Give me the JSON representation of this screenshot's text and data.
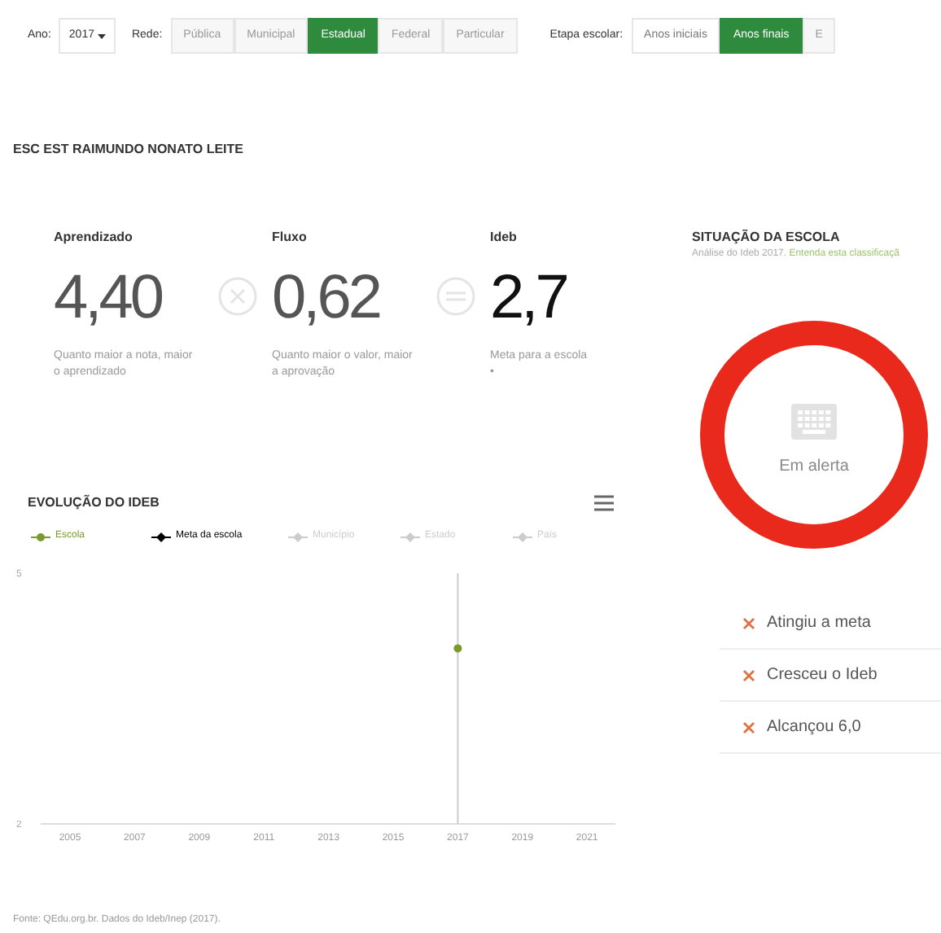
{
  "filters": {
    "year": {
      "label": "Ano:",
      "value": "2017"
    },
    "network": {
      "label": "Rede:",
      "options": [
        {
          "label": "Pública",
          "selected": false,
          "disabled": true
        },
        {
          "label": "Municipal",
          "selected": false,
          "disabled": true
        },
        {
          "label": "Estadual",
          "selected": true,
          "disabled": false
        },
        {
          "label": "Federal",
          "selected": false,
          "disabled": true
        },
        {
          "label": "Particular",
          "selected": false,
          "disabled": true
        }
      ]
    },
    "stage": {
      "label": "Etapa escolar:",
      "options": [
        {
          "label": "Anos iniciais",
          "selected": false,
          "disabled": false
        },
        {
          "label": "Anos finais",
          "selected": true,
          "disabled": false
        },
        {
          "label": "E",
          "selected": false,
          "disabled": true
        }
      ]
    }
  },
  "school_name": "ESC EST RAIMUNDO NONATO LEITE",
  "metrics": [
    {
      "title": "Aprendizado",
      "value": "4,40",
      "description": "Quanto maior a nota, maior o aprendizado",
      "highlight": false
    },
    {
      "title": "Fluxo",
      "value": "0,62",
      "description": "Quanto maior o valor, maior a aprovação",
      "highlight": false
    },
    {
      "title": "Ideb",
      "value": "2,7",
      "description": "Meta para a escola",
      "note": "•",
      "highlight": true
    }
  ],
  "situation": {
    "title": "SITUAÇÃO DA ESCOLA",
    "subtitle": "Análise do Ideb 2017.",
    "link": "Entenda esta classificaçã",
    "status": "Em alerta",
    "color": "#e8291c",
    "checks": [
      {
        "label": "Atingiu a meta",
        "met": false
      },
      {
        "label": "Cresceu o Ideb",
        "met": false
      },
      {
        "label": "Alcançou 6,0",
        "met": false
      }
    ]
  },
  "evolution": {
    "title": "EVOLUÇÃO DO IDEB",
    "chart_data": {
      "type": "line",
      "x": [
        "2005",
        "2007",
        "2009",
        "2011",
        "2013",
        "2015",
        "2017",
        "2019",
        "2021"
      ],
      "series": [
        {
          "name": "Escola",
          "color": "#7a9a2a",
          "marker": "circle",
          "values": [
            null,
            null,
            null,
            null,
            null,
            null,
            4.1,
            null,
            null
          ]
        },
        {
          "name": "Meta da escola",
          "color": "#000000",
          "marker": "diamond",
          "values": [
            null,
            null,
            null,
            null,
            null,
            null,
            null,
            null,
            null
          ]
        },
        {
          "name": "Município",
          "color": "#cccccc",
          "marker": "diamond",
          "values": [
            null,
            null,
            null,
            null,
            null,
            null,
            null,
            null,
            null
          ]
        },
        {
          "name": "Estado",
          "color": "#cccccc",
          "marker": "diamond",
          "values": [
            null,
            null,
            null,
            null,
            null,
            null,
            null,
            null,
            null
          ]
        },
        {
          "name": "País",
          "color": "#cccccc",
          "marker": "diamond",
          "values": [
            null,
            null,
            null,
            null,
            null,
            null,
            null,
            null,
            null
          ]
        }
      ],
      "ref_lines": [
        {
          "axis": "x",
          "value": "2017",
          "color": "#cccccc"
        }
      ],
      "ylim": [
        2,
        5
      ],
      "yticks": [
        2,
        5
      ]
    }
  },
  "source": "Fonte: QEdu.org.br. Dados do Ideb/Inep (2017)."
}
